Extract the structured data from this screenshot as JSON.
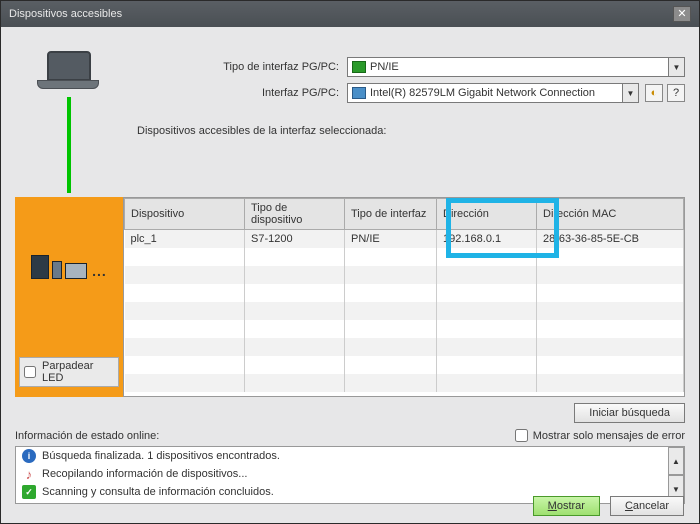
{
  "window": {
    "title": "Dispositivos accesibles"
  },
  "form": {
    "pgpc_type_label": "Tipo de interfaz PG/PC:",
    "pgpc_type_value": "PN/IE",
    "pgpc_if_label": "Interfaz PG/PC:",
    "pgpc_if_value": "Intel(R) 82579LM Gigabit Network Connection"
  },
  "section_label": "Dispositivos accesibles de la interfaz seleccionada:",
  "led_label": "Parpadear LED",
  "columns": {
    "device": "Dispositivo",
    "devtype": "Tipo de dispositivo",
    "iftype": "Tipo de interfaz",
    "addr": "Dirección",
    "mac": "Dirección MAC"
  },
  "rows": [
    {
      "device": "plc_1",
      "devtype": "S7-1200",
      "iftype": "PN/IE",
      "addr": "192.168.0.1",
      "mac": "28-63-36-85-5E-CB"
    }
  ],
  "buttons": {
    "search": "Iniciar búsqueda",
    "show": "Mostrar",
    "cancel": "Cancelar"
  },
  "status": {
    "header": "Información de estado online:",
    "filter": "Mostrar solo mensajes de error",
    "l1": "Búsqueda finalizada. 1 dispositivos encontrados.",
    "l2": "Recopilando información de dispositivos...",
    "l3": "Scanning y consulta de información concluidos."
  }
}
